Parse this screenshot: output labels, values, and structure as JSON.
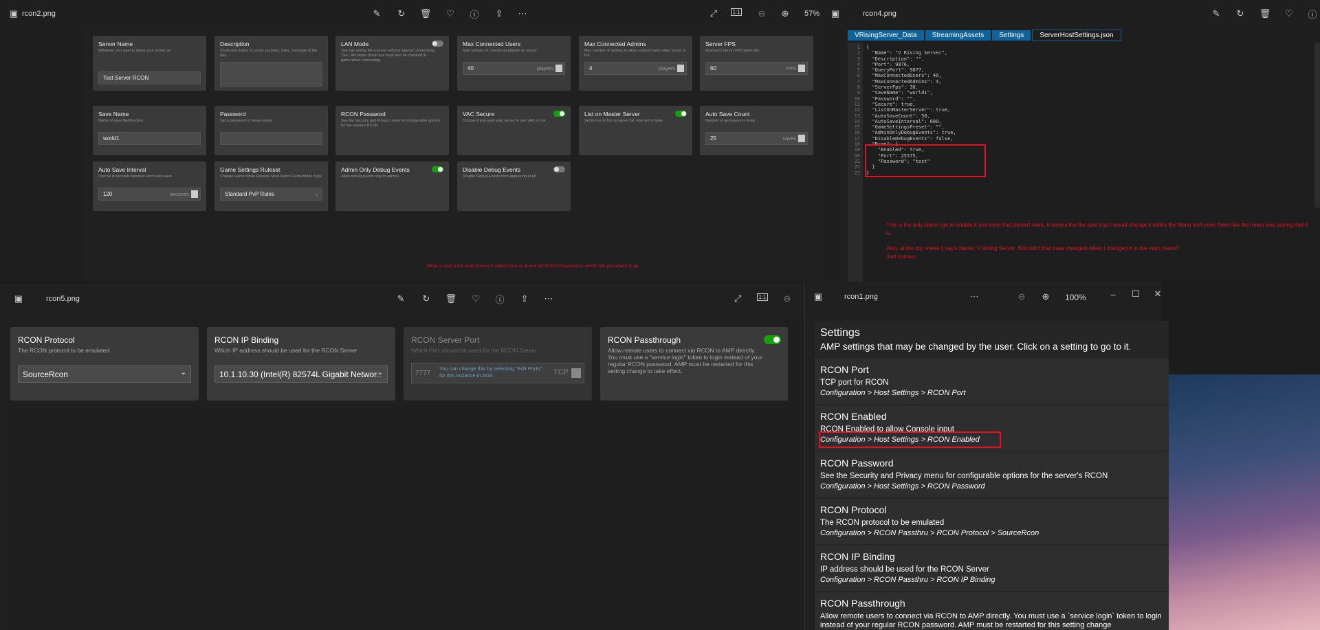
{
  "rcon2": {
    "filename": "rcon2.png",
    "zoom": "57%",
    "cards": [
      {
        "title": "Server Name",
        "desc": "Whatever you want to name your server as",
        "value": "Test Server RCON"
      },
      {
        "title": "Description",
        "desc": "Short description of server purpose, rules, message of the day"
      },
      {
        "title": "LAN Mode",
        "desc": "Use this setting for a server without internet connectivity. The LAN Mode check box must also be checked in-game when connecting"
      },
      {
        "title": "Max Connected Users",
        "desc": "Max number of concurrent players on server",
        "value": "40",
        "unit": "players"
      },
      {
        "title": "Max Connected Admins",
        "desc": "Max number of admins to allow connect even when server is full",
        "value": "4",
        "unit": "players"
      },
      {
        "title": "Server FPS",
        "desc": "Maximum Server FPS when idle",
        "value": "60",
        "unit": "FPS"
      },
      {
        "title": "Save Name",
        "desc": "Name of save file/directory",
        "value": "world1"
      },
      {
        "title": "Password",
        "desc": "Set a password or leave empty"
      },
      {
        "title": "RCON Password",
        "desc": "See the Security and Privacy menu for configurable options for the server's RCON"
      },
      {
        "title": "VAC Secure",
        "desc": "Choose if you want your server to use VAC or not"
      },
      {
        "title": "List on Master Server",
        "desc": "Set to true to list on server list, else set to false"
      },
      {
        "title": "Auto Save Count",
        "desc": "Number of autosaves to keep",
        "value": "25",
        "unit": "saves"
      },
      {
        "title": "Auto Save Interval",
        "desc": "Interval in seconds between each auto save",
        "value": "120",
        "unit": "seconds"
      },
      {
        "title": "Game Settings Ruleset",
        "desc": "Change Game Mode Ruleset. Must Match Game Mode Type",
        "value": "Standard PvP Rules"
      },
      {
        "title": "Admin Only Debug Events",
        "desc": "Allow debug events only to admins"
      },
      {
        "title": "Disable Debug Events",
        "desc": "Disable Debug Events from appearing at all"
      }
    ],
    "note": "What is said in the search doesn't reflect here at all just the RCON Password in which tells you where to go."
  },
  "rcon4": {
    "filename": "rcon4.png",
    "crumbs": [
      "VRisingServer_Data",
      "StreamingAssets",
      "Settings",
      "ServerHostSettings.json"
    ],
    "lines": [
      "{",
      "  \"Name\": \"V Rising Server\",",
      "  \"Description\": \"\",",
      "  \"Port\": 9876,",
      "  \"QueryPort\": 9877,",
      "  \"MaxConnectedUsers\": 40,",
      "  \"MaxConnectedAdmins\": 4,",
      "  \"ServerFps\": 30,",
      "  \"SaveName\": \"world1\",",
      "  \"Password\": \"\",",
      "  \"Secure\": true,",
      "  \"ListOnMasterServer\": true,",
      "  \"AutoSaveCount\": 50,",
      "  \"AutoSaveInterval\": 600,",
      "  \"GameSettingsPreset\": \"\",",
      "  \"AdminOnlyDebugEvents\": true,",
      "  \"DisableDebugEvents\": false,",
      "  \"Rcon\": {",
      "    \"Enabled\": true,",
      "    \"Port\": 25575,",
      "    \"Password\": \"test\"",
      "  }",
      "}"
    ],
    "note1": "This is the only place I go to enable it and even that doesn't work, it seems the the spot that I would change it within the Menu isn't even there like the menu was saying that it is.",
    "note2": "Also, at the top where it say's Name: V Rising Server. Shouldn't that have changed when I changed it in the main menu?",
    "note3": "Just curious."
  },
  "rcon5": {
    "filename": "rcon5.png",
    "cards": [
      {
        "title": "RCON Protocol",
        "desc": "The RCON protocol to be emulated",
        "value": "SourceRcon"
      },
      {
        "title": "RCON IP Binding",
        "desc": "Which IP address should be used for the RCON Server",
        "value": "10.1.10.30 (Intel(R) 82574L Gigabit Network"
      },
      {
        "title": "RCON Server Port",
        "desc": "Which Port should be used for the RCON Server",
        "value": "7777",
        "hint": "You can change this by selecting \"Edit Ports\" for this instance in ADS.",
        "unit": "TCP"
      },
      {
        "title": "RCON Passthrough",
        "desc": "Allow remote users to connect via RCON to AMP directly. You must use a \"service login\" token to login instead of your regular RCON password. AMP must be restarted for this setting change to take effect."
      }
    ]
  },
  "rcon1": {
    "filename": "rcon1.png",
    "zoom": "100%",
    "heading": "Settings",
    "sub": "AMP settings that may be changed by the user. Click on a setting to go to it.",
    "items": [
      {
        "title": "RCON Port",
        "desc": "TCP port for RCON",
        "path": "Configuration > Host Settings > RCON Port"
      },
      {
        "title": "RCON Enabled",
        "desc": "RCON Enabled to allow Console input",
        "path": "Configuration > Host Settings > RCON Enabled"
      },
      {
        "title": "RCON Password",
        "desc": "See the Security and Privacy menu for configurable options for the server's RCON",
        "path": "Configuration > Host Settings > RCON Password"
      },
      {
        "title": "RCON Protocol",
        "desc": "The RCON protocol to be emulated",
        "path": "Configuration > RCON Passthru > RCON Protocol > SourceRcon"
      },
      {
        "title": "RCON IP Binding",
        "desc": "IP address should be used for the RCON Server",
        "path": "Configuration > RCON Passthru > RCON IP Binding"
      },
      {
        "title": "RCON Passthrough",
        "desc": "Allow remote users to connect via RCON to AMP directly. You must use a `service login` token to login instead of your regular RCON password. AMP must be restarted for this setting change"
      }
    ]
  }
}
